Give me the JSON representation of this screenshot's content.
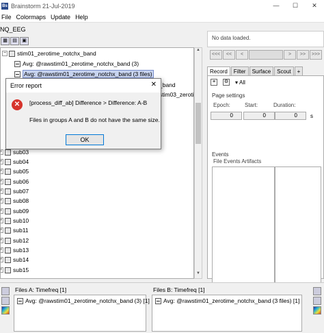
{
  "window": {
    "title": "Brainstorm 21-Jul-2019",
    "app_icon": "Bs",
    "controls": [
      "—",
      "☐",
      "✕"
    ]
  },
  "menubar": [
    "File",
    "Colormaps",
    "Update",
    "Help"
  ],
  "left": {
    "protocol_label": "NQ_EEG",
    "tree": {
      "condition": "stim01_zerotime_notchx_band",
      "items": [
        {
          "label": "Avg: @rawstim01_zerotime_notchx_band (3)",
          "selected": false
        },
        {
          "label": "Avg: @rawstim01_zerotime_notchx_band (3 files)",
          "selected": true
        }
      ],
      "partial_rows": [
        "_band",
        "stim03_zerotim"
      ],
      "subjects": [
        "sub03",
        "sub04",
        "sub05",
        "sub06",
        "sub07",
        "sub08",
        "sub09",
        "sub10",
        "sub11",
        "sub12",
        "sub13",
        "sub14",
        "sub15"
      ]
    }
  },
  "right": {
    "nodata": "No data loaded.",
    "nav_buttons": [
      "<<<",
      "<<",
      "<",
      ">",
      ">>",
      ">>>"
    ],
    "tabs": [
      "Record",
      "Filter",
      "Surface",
      "Scout",
      "+"
    ],
    "all_label": "All",
    "page_settings": {
      "title": "Page settings",
      "epoch_label": "Epoch:",
      "epoch_value": "0",
      "start_label": "Start:",
      "start_value": "0",
      "duration_label": "Duration:",
      "duration_value": "0",
      "unit": "s"
    },
    "events": {
      "title": "Events",
      "menus": "File   Events   Artifacts"
    }
  },
  "bottom": {
    "files_a_title": "Files A: Timefreq [1]",
    "files_a_item": "Avg: @rawstim01_zerotime_notchx_band (3) [1]",
    "files_b_title": "Files B: Timefreq [1]",
    "files_b_item": "Avg: @rawstim01_zerotime_notchx_band (3 files) [1]"
  },
  "dialog": {
    "title": "Error report",
    "close": "✕",
    "message_line1": "[process_diff_ab]  Difference > Difference: A-B",
    "message_line2": "Files in groups A and B do not have the same size.",
    "ok_label": "OK"
  }
}
